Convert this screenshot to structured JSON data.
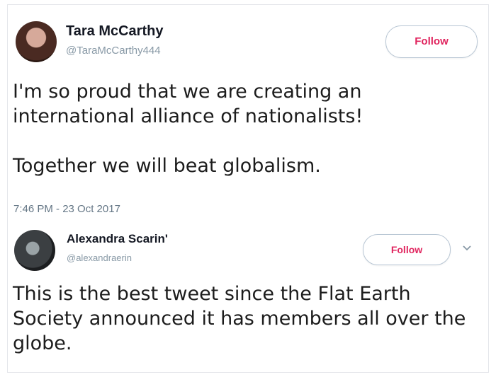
{
  "tweet": {
    "author_name": "Tara McCarthy",
    "author_handle": "@TaraMcCarthy444",
    "follow_label": "Follow",
    "text_line1": "I'm so proud that we are creating an international alliance of nationalists!",
    "text_line2": "Together we will beat globalism.",
    "timestamp": "7:46 PM - 23 Oct 2017"
  },
  "reply": {
    "author_name": "Alexandra Scarin'",
    "author_handle": "@alexandraerin",
    "follow_label": "Follow",
    "text": "This is the best tweet since the Flat Earth Society announced it has members all over the globe."
  },
  "icons": {
    "more": "chevron-down-icon"
  },
  "colors": {
    "follow_text": "#e0245e",
    "handle": "#8899a6",
    "timestamp": "#657786"
  }
}
